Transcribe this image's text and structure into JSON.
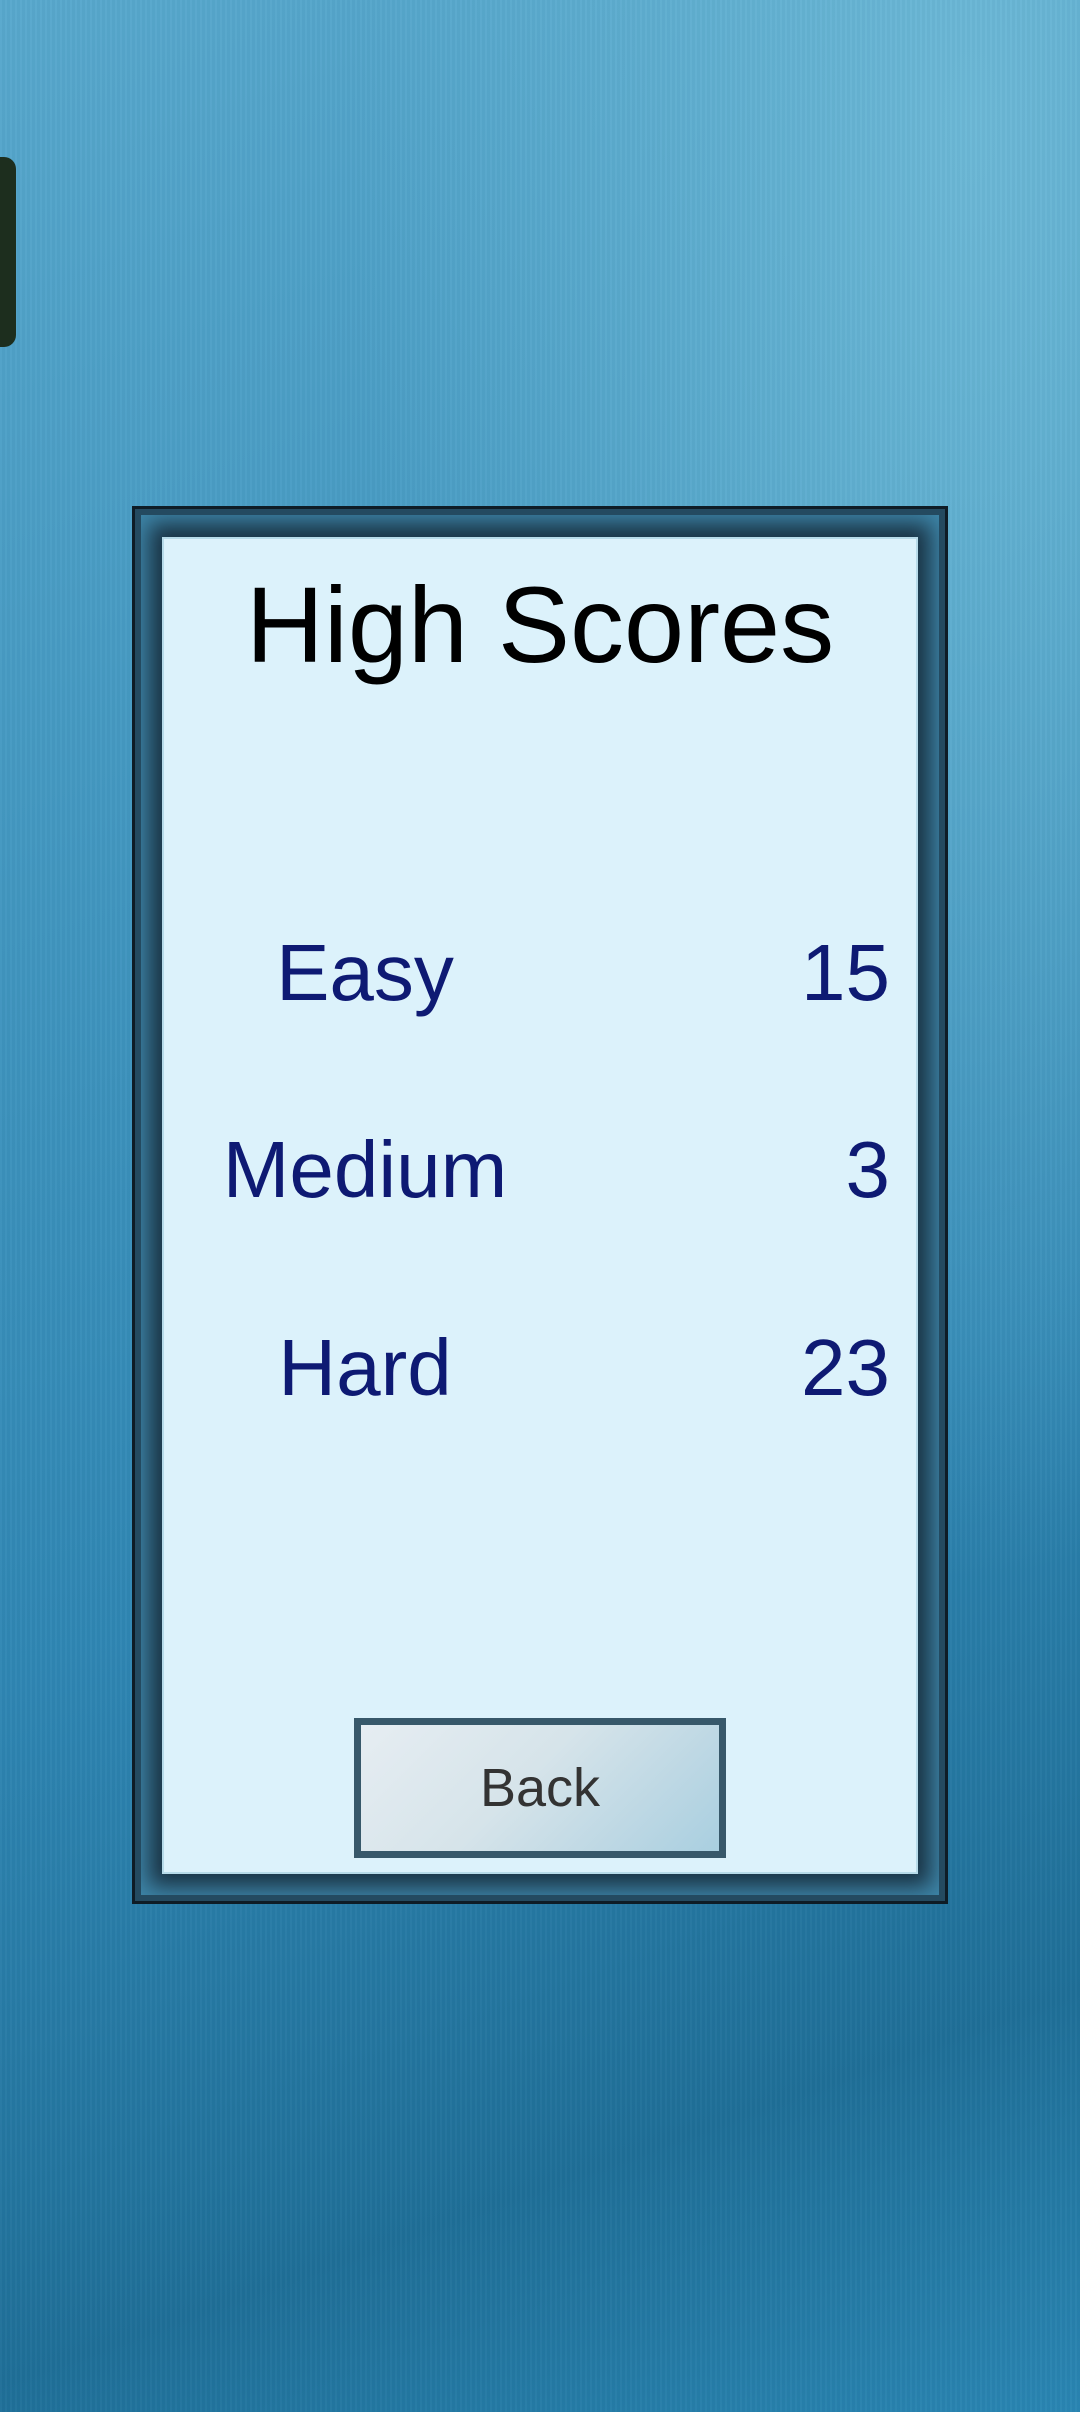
{
  "title": "High Scores",
  "scores": [
    {
      "label": "Easy",
      "value": "15"
    },
    {
      "label": "Medium",
      "value": "3"
    },
    {
      "label": "Hard",
      "value": "23"
    }
  ],
  "back_label": "Back",
  "colors": {
    "background": "#3a90bc",
    "panel": "#dcf2fb",
    "score_text": "#0e1a73",
    "button_border": "#37586a"
  }
}
